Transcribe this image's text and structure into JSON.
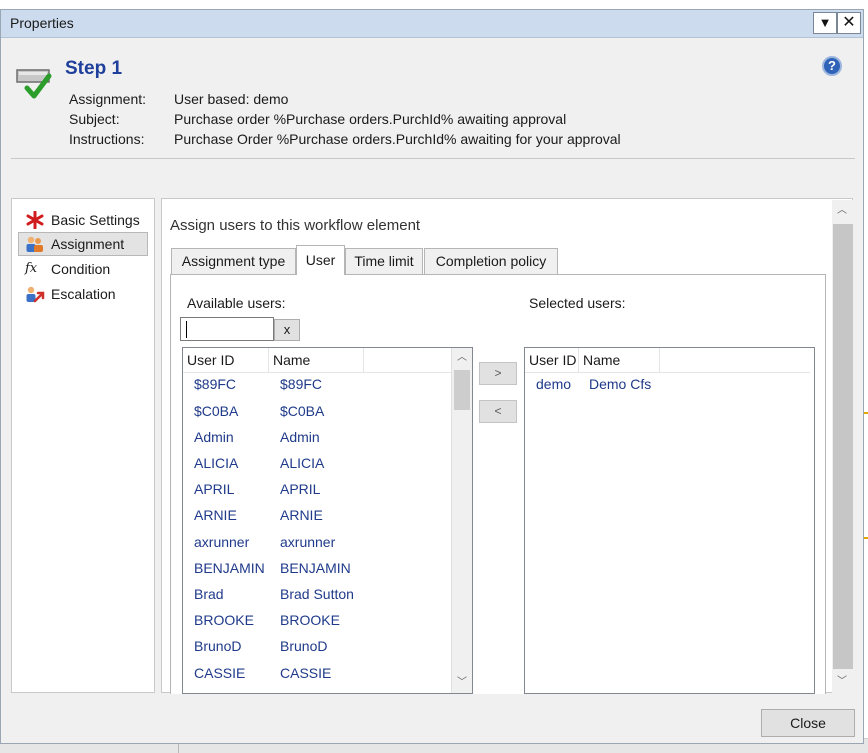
{
  "dialog": {
    "title": "Properties"
  },
  "header": {
    "step_title": "Step 1",
    "help_glyph": "?",
    "assignment_label": "Assignment:",
    "assignment_value": "User based: demo",
    "subject_label": "Subject:",
    "subject_value": "Purchase order %Purchase orders.PurchId% awaiting approval",
    "instructions_label": "Instructions:",
    "instructions_value": "Purchase Order %Purchase orders.PurchId% awaiting for your approval"
  },
  "nav": {
    "items": [
      {
        "label": "Basic Settings",
        "icon": "asterisk-icon",
        "selected": false
      },
      {
        "label": "Assignment",
        "icon": "users-icon",
        "selected": true
      },
      {
        "label": "Condition",
        "icon": "function-icon",
        "selected": false
      },
      {
        "label": "Escalation",
        "icon": "escalation-icon",
        "selected": false
      }
    ]
  },
  "main": {
    "heading": "Assign users to this workflow element",
    "tabs": [
      {
        "label": "Assignment type",
        "active": false
      },
      {
        "label": "User",
        "active": true
      },
      {
        "label": "Time limit",
        "active": false
      },
      {
        "label": "Completion policy",
        "active": false
      }
    ],
    "available_label": "Available users:",
    "selected_label": "Selected users:",
    "filter": {
      "value": "",
      "clear_label": "x"
    },
    "add_label": ">",
    "remove_label": "<",
    "available_grid": {
      "columns": [
        "User ID",
        "Name"
      ],
      "rows": [
        [
          "$89FC",
          "$89FC"
        ],
        [
          "$C0BA",
          "$C0BA"
        ],
        [
          "Admin",
          "Admin"
        ],
        [
          "ALICIA",
          "ALICIA"
        ],
        [
          "APRIL",
          "APRIL"
        ],
        [
          "ARNIE",
          "ARNIE"
        ],
        [
          "axrunner",
          "axrunner"
        ],
        [
          "BENJAMIN",
          "BENJAMIN"
        ],
        [
          "Brad",
          "Brad Sutton"
        ],
        [
          "BROOKE",
          "BROOKE"
        ],
        [
          "BrunoD",
          "BrunoD"
        ],
        [
          "CASSIE",
          "CASSIE"
        ]
      ]
    },
    "selected_grid": {
      "columns": [
        "User ID",
        "Name"
      ],
      "rows": [
        [
          "demo",
          "Demo Cfs"
        ]
      ]
    }
  },
  "footer": {
    "close_label": "Close"
  },
  "colors": {
    "link_blue": "#1f3a8a",
    "title_blue": "#1e3f9b",
    "titlebar": "#ccdcee"
  }
}
